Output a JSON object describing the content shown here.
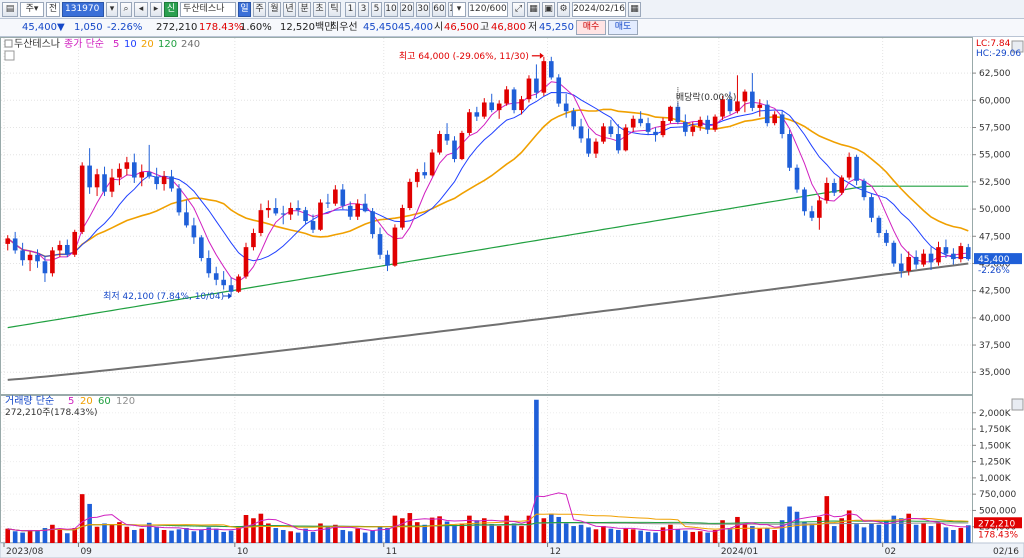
{
  "toolbar": {
    "menu_label": "주",
    "code_label": "전",
    "code_value": "131970",
    "credit_badge": "신",
    "stock_name": "두산테스나",
    "periods": [
      "일",
      "주",
      "월",
      "년",
      "분",
      "초",
      "틱"
    ],
    "period_selected": "일",
    "minutes": [
      "1",
      "3",
      "5",
      "10",
      "20",
      "30",
      "60",
      "120"
    ],
    "count_value": "120/600",
    "date_value": "2024/02/16"
  },
  "quote": {
    "price": "45,400",
    "change_arrow": "▼",
    "change": "1,050",
    "change_rate": "-2.26%",
    "volume": "272,210",
    "volume_ratio": "178.43%",
    "turnover": "1.60%",
    "amount": "12,520백만",
    "best_bid_label": "최우선",
    "best_ask": "45,450",
    "best_bid": "45,400",
    "open_label": "시",
    "open": "46,500",
    "high_label": "고",
    "high": "46,800",
    "low_label": "저",
    "low": "45,250",
    "buy_label": "매수",
    "sell_label": "매도"
  },
  "colors": {
    "up": "#e00000",
    "down": "#1f5fd8",
    "ma5": "#d020c0",
    "ma10": "#2040ff",
    "ma20": "#f0a000",
    "ma120": "#20a040",
    "ma240": "#707070"
  },
  "chart_data": [
    {
      "type": "candlestick",
      "legend": {
        "stock": "두산테스나",
        "ma_label": "종가 단순",
        "periods": [
          "5",
          "10",
          "20",
          "120",
          "240"
        ]
      },
      "y_ticks": [
        35000,
        37500,
        40000,
        42500,
        45000,
        47500,
        50000,
        52500,
        55000,
        57500,
        60000,
        62500
      ],
      "y_tick_labels": [
        "35,000",
        "37,500",
        "40,000",
        "42,500",
        "45,000",
        "47,500",
        "50,000",
        "52,500",
        "55,000",
        "57,500",
        "60,000",
        "62,500"
      ],
      "ylim": [
        33000,
        64900
      ],
      "x_labels": [
        {
          "index": 0,
          "label": "2023/08"
        },
        {
          "index": 10,
          "label": "09"
        },
        {
          "index": 31,
          "label": "10"
        },
        {
          "index": 51,
          "label": "11"
        },
        {
          "index": 73,
          "label": "12"
        },
        {
          "index": 96,
          "label": "2024/01"
        },
        {
          "index": 118,
          "label": "02"
        }
      ],
      "top_right_labels": [
        "LC:7.84",
        "HC:-29.06"
      ],
      "last_price_label": "45,400",
      "last_change_label": "-2.26%",
      "annotations": {
        "high": {
          "text": "최고 64,000 (-29.06%, 11/30)",
          "index": 72,
          "value": 64000
        },
        "low": {
          "text": "최저 42,100 (7.84%, 10/04)",
          "index": 30,
          "value": 42100
        },
        "dividend": {
          "text": "배당락(0.00%)",
          "index": 90
        }
      },
      "ohlc": [
        [
          46800,
          47600,
          46200,
          47300
        ],
        [
          47300,
          47900,
          45900,
          46200
        ],
        [
          46200,
          46900,
          44800,
          45300
        ],
        [
          45300,
          46100,
          44300,
          45800
        ],
        [
          45800,
          46300,
          44600,
          45200
        ],
        [
          45200,
          45700,
          43300,
          44100
        ],
        [
          44100,
          46500,
          43800,
          46200
        ],
        [
          46200,
          47100,
          45600,
          46700
        ],
        [
          46700,
          47200,
          45600,
          45800
        ],
        [
          45800,
          48100,
          45600,
          47900
        ],
        [
          47900,
          54300,
          47700,
          54000
        ],
        [
          54000,
          55600,
          51400,
          52000
        ],
        [
          52000,
          53700,
          51200,
          53200
        ],
        [
          53200,
          53900,
          51200,
          51600
        ],
        [
          51600,
          53700,
          51100,
          52900
        ],
        [
          52900,
          54200,
          52200,
          53700
        ],
        [
          53700,
          54800,
          53100,
          54300
        ],
        [
          54300,
          55100,
          52400,
          52900
        ],
        [
          52900,
          54100,
          52100,
          53400
        ],
        [
          53400,
          55900,
          52800,
          53000
        ],
        [
          53000,
          53800,
          51800,
          52300
        ],
        [
          52300,
          53500,
          51700,
          53000
        ],
        [
          53000,
          53600,
          51600,
          51900
        ],
        [
          51900,
          52300,
          49400,
          49700
        ],
        [
          49700,
          50800,
          48300,
          48500
        ],
        [
          48500,
          49200,
          46800,
          47400
        ],
        [
          47400,
          47600,
          45200,
          45500
        ],
        [
          45500,
          46200,
          43700,
          44100
        ],
        [
          44100,
          44700,
          43000,
          43500
        ],
        [
          43500,
          44300,
          42600,
          43000
        ],
        [
          43000,
          43700,
          42100,
          42400
        ],
        [
          42400,
          44000,
          42300,
          43800
        ],
        [
          43800,
          46900,
          43600,
          46500
        ],
        [
          46500,
          48200,
          46200,
          47800
        ],
        [
          47800,
          50500,
          47500,
          49900
        ],
        [
          49900,
          50800,
          49200,
          50100
        ],
        [
          50100,
          51000,
          49400,
          49600
        ],
        [
          49600,
          50300,
          48600,
          49500
        ],
        [
          49500,
          50600,
          49000,
          50100
        ],
        [
          50100,
          50800,
          49400,
          49900
        ],
        [
          49900,
          50200,
          48600,
          48900
        ],
        [
          48900,
          49500,
          47800,
          48100
        ],
        [
          48100,
          50900,
          48000,
          50600
        ],
        [
          50600,
          51400,
          50100,
          50500
        ],
        [
          50500,
          52200,
          50300,
          51800
        ],
        [
          51800,
          52300,
          50000,
          50300
        ],
        [
          50300,
          50700,
          49000,
          49300
        ],
        [
          49300,
          50900,
          49000,
          50500
        ],
        [
          50500,
          51400,
          49700,
          49800
        ],
        [
          49800,
          50100,
          47300,
          47700
        ],
        [
          47700,
          48300,
          45400,
          45800
        ],
        [
          45800,
          46200,
          44300,
          44800
        ],
        [
          44800,
          48600,
          44700,
          48300
        ],
        [
          48300,
          50400,
          48100,
          50100
        ],
        [
          50100,
          52800,
          49900,
          52500
        ],
        [
          52500,
          53700,
          52000,
          53400
        ],
        [
          53400,
          54300,
          52800,
          53100
        ],
        [
          53100,
          55500,
          53000,
          55200
        ],
        [
          55200,
          57200,
          55000,
          56900
        ],
        [
          56900,
          57900,
          55900,
          56300
        ],
        [
          56300,
          56700,
          54300,
          54600
        ],
        [
          54600,
          57200,
          54500,
          57000
        ],
        [
          57000,
          59200,
          56800,
          58900
        ],
        [
          58900,
          59400,
          58100,
          58500
        ],
        [
          58500,
          60200,
          58300,
          59800
        ],
        [
          59800,
          60600,
          58900,
          59100
        ],
        [
          59100,
          60000,
          58300,
          59700
        ],
        [
          59700,
          61300,
          59500,
          61000
        ],
        [
          61000,
          61200,
          58800,
          59100
        ],
        [
          59100,
          60400,
          58700,
          60100
        ],
        [
          60100,
          62300,
          59800,
          62000
        ],
        [
          62000,
          63300,
          60200,
          60700
        ],
        [
          60700,
          64000,
          60400,
          63600
        ],
        [
          63600,
          64000,
          61900,
          62100
        ],
        [
          62100,
          62400,
          59400,
          59700
        ],
        [
          59700,
          60600,
          58400,
          59000
        ],
        [
          59000,
          59300,
          57300,
          57600
        ],
        [
          57600,
          58300,
          56100,
          56500
        ],
        [
          56500,
          57400,
          54800,
          55100
        ],
        [
          55100,
          56500,
          54700,
          56200
        ],
        [
          56200,
          57900,
          56000,
          57600
        ],
        [
          57600,
          58200,
          56600,
          56900
        ],
        [
          56900,
          57800,
          55100,
          55400
        ],
        [
          55400,
          57800,
          55300,
          57500
        ],
        [
          57500,
          58600,
          57100,
          58300
        ],
        [
          58300,
          59000,
          57600,
          57900
        ],
        [
          57900,
          58400,
          56800,
          57100
        ],
        [
          57100,
          57500,
          56200,
          56800
        ],
        [
          56800,
          58400,
          56600,
          58100
        ],
        [
          58100,
          59500,
          57900,
          59400
        ],
        [
          59400,
          59800,
          57800,
          58000
        ],
        [
          58000,
          58700,
          56700,
          57100
        ],
        [
          57100,
          58000,
          56700,
          57600
        ],
        [
          57600,
          58500,
          57200,
          58200
        ],
        [
          58200,
          58600,
          56900,
          57300
        ],
        [
          57300,
          58700,
          57100,
          58500
        ],
        [
          58500,
          60400,
          58200,
          60100
        ],
        [
          60100,
          60800,
          58700,
          59000
        ],
        [
          59000,
          62300,
          58800,
          59900
        ],
        [
          59900,
          61000,
          58900,
          60800
        ],
        [
          60800,
          62500,
          59000,
          59300
        ],
        [
          59300,
          60100,
          58500,
          59600
        ],
        [
          59600,
          60000,
          57600,
          57900
        ],
        [
          57900,
          59000,
          57700,
          58700
        ],
        [
          58700,
          59000,
          56500,
          56900
        ],
        [
          56900,
          57300,
          53500,
          53800
        ],
        [
          53800,
          54100,
          51500,
          51800
        ],
        [
          51800,
          52000,
          49400,
          49800
        ],
        [
          49800,
          50300,
          48900,
          49200
        ],
        [
          49200,
          51200,
          48100,
          50800
        ],
        [
          50800,
          52900,
          50500,
          52400
        ],
        [
          52400,
          52800,
          51200,
          51500
        ],
        [
          51500,
          53100,
          51300,
          52900
        ],
        [
          52900,
          55200,
          52700,
          54800
        ],
        [
          54800,
          55000,
          52200,
          52600
        ],
        [
          52600,
          52800,
          50800,
          51100
        ],
        [
          51100,
          51400,
          48800,
          49200
        ],
        [
          49200,
          49400,
          47400,
          47800
        ],
        [
          47800,
          48100,
          46600,
          46900
        ],
        [
          46900,
          47100,
          44700,
          45000
        ],
        [
          45000,
          45900,
          43700,
          44300
        ],
        [
          44300,
          46100,
          43900,
          45600
        ],
        [
          45600,
          46200,
          44500,
          44900
        ],
        [
          44900,
          46300,
          44700,
          45900
        ],
        [
          45900,
          46500,
          44400,
          45100
        ],
        [
          45100,
          47000,
          44800,
          46500
        ],
        [
          46500,
          47200,
          45500,
          45900
        ],
        [
          45900,
          46400,
          44900,
          45400
        ],
        [
          45400,
          46900,
          45100,
          46600
        ],
        [
          46500,
          46800,
          45250,
          45400
        ]
      ],
      "ma20_last": 47600,
      "ma120_last": 52100,
      "ma120_first": 39100,
      "ma240_last": 45000,
      "ma240_first": 34300
    },
    {
      "type": "bar",
      "legend": {
        "label": "거래량 단순",
        "periods": [
          "5",
          "20",
          "60",
          "120"
        ]
      },
      "current_text": "272,210주(178.43%)",
      "y_ticks": [
        250000,
        500000,
        750000,
        1000000,
        1250000,
        1500000,
        1750000,
        2000000
      ],
      "y_tick_labels": [
        "250,000",
        "500,000",
        "750,000",
        "1,000K",
        "1,250K",
        "1,500K",
        "1,750K",
        "2,000K"
      ],
      "ylim": [
        0,
        2150000
      ],
      "last_value_label": "272,210",
      "last_ratio_label": "178.43%",
      "volumes": [
        220000,
        180000,
        160000,
        200000,
        190000,
        230000,
        280000,
        210000,
        150000,
        230000,
        750000,
        600000,
        250000,
        300000,
        280000,
        320000,
        250000,
        200000,
        220000,
        310000,
        250000,
        200000,
        190000,
        210000,
        230000,
        180000,
        200000,
        240000,
        220000,
        170000,
        190000,
        260000,
        430000,
        380000,
        450000,
        300000,
        230000,
        200000,
        180000,
        160000,
        220000,
        170000,
        300000,
        250000,
        280000,
        200000,
        180000,
        220000,
        160000,
        190000,
        260000,
        230000,
        420000,
        380000,
        460000,
        320000,
        280000,
        390000,
        410000,
        330000,
        280000,
        300000,
        420000,
        350000,
        380000,
        290000,
        260000,
        420000,
        300000,
        260000,
        420000,
        2200000,
        380000,
        450000,
        400000,
        300000,
        260000,
        280000,
        240000,
        210000,
        260000,
        220000,
        200000,
        230000,
        210000,
        190000,
        170000,
        160000,
        240000,
        280000,
        210000,
        190000,
        170000,
        180000,
        160000,
        200000,
        350000,
        230000,
        400000,
        300000,
        260000,
        220000,
        230000,
        200000,
        350000,
        560000,
        480000,
        330000,
        300000,
        400000,
        720000,
        260000,
        380000,
        500000,
        290000,
        240000,
        300000,
        280000,
        350000,
        420000,
        380000,
        450000,
        280000,
        300000,
        260000,
        310000,
        240000,
        200000,
        230000,
        272210
      ]
    }
  ]
}
